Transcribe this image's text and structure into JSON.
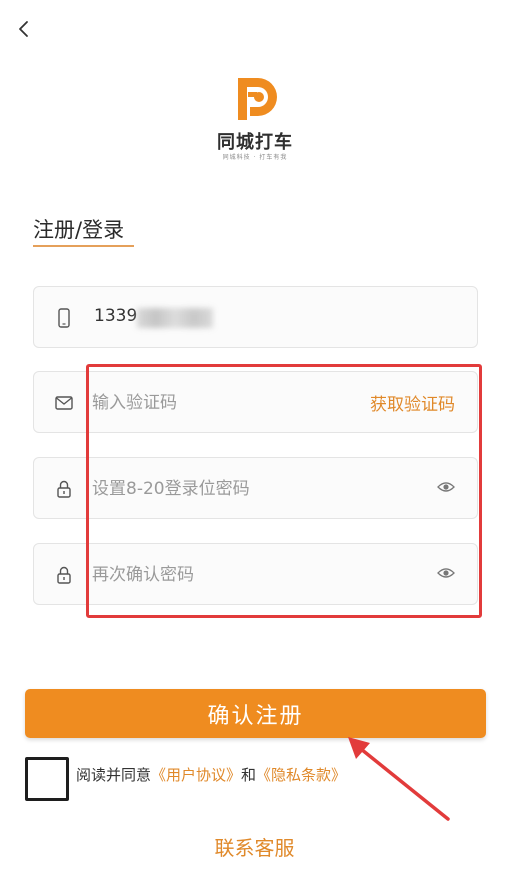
{
  "header": {
    "back_icon": "chevron-left-icon"
  },
  "logo": {
    "name": "同城打车",
    "tagline": "同城科技 · 打车有我"
  },
  "page": {
    "title": "注册/登录"
  },
  "form": {
    "phone": {
      "value": "1339",
      "icon": "phone-icon",
      "masked": true
    },
    "code": {
      "placeholder": "输入验证码",
      "icon": "mail-icon",
      "action_label": "获取验证码"
    },
    "password": {
      "placeholder": "设置8-20登录位密码",
      "icon": "lock-icon",
      "toggle_icon": "eye-icon"
    },
    "confirm_password": {
      "placeholder": "再次确认密码",
      "icon": "lock-icon",
      "toggle_icon": "eye-icon"
    }
  },
  "submit": {
    "label": "确认注册"
  },
  "agreement": {
    "prefix": "阅读并同意",
    "user_agreement": "《用户协议》",
    "conjunction": "和",
    "privacy_policy": "《隐私条款》",
    "checked": false
  },
  "service": {
    "label": "联系客服"
  },
  "colors": {
    "accent": "#ef8c20",
    "link": "#e0892a",
    "annotation": "#e23b3b"
  }
}
